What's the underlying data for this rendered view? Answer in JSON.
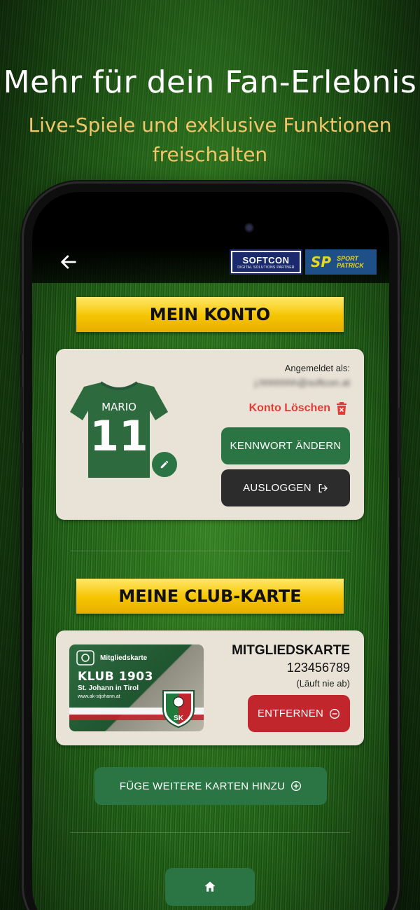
{
  "hero": {
    "title": "Mehr für dein Fan-Erlebnis",
    "subtitle": "Live-Spiele und exklusive Funktionen freischalten"
  },
  "header": {
    "back_icon": "arrow-left-icon",
    "logos": {
      "softcon_name": "SOFTCON",
      "softcon_tagline": "DIGITAL SOLUTIONS PARTNER",
      "sp_mark": "SP",
      "sp_line1": "SPORT",
      "sp_line2": "PATRICK"
    }
  },
  "account": {
    "section_title": "MEIN KONTO",
    "jersey_name": "MARIO",
    "jersey_number": "11",
    "logged_in_label": "Angemeldet als:",
    "email": "j.hhhhhhh@softcon.at",
    "delete_label": "Konto Löschen",
    "change_password_label": "KENNWORT ÄNDERN",
    "logout_label": "AUSLOGGEN"
  },
  "club": {
    "section_title": "MEINE CLUB-KARTE",
    "card_image": {
      "header": "Mitgliedskarte",
      "club_name": "KLUB 1903",
      "location": "St. Johann in Tirol",
      "website": "www.ak-stjohann.at",
      "crest_letters": "SK"
    },
    "card_type": "MITGLIEDSKARTE",
    "card_number": "123456789",
    "expiry": "(Läuft nie ab)",
    "remove_label": "ENTFERNEN",
    "add_more_label": "FÜGE WEITERE KARTEN HINZU"
  },
  "colors": {
    "primary_green": "#2b7443",
    "accent_yellow": "#f5c400",
    "danger_red": "#c0262c",
    "subtitle_gold": "#f2c56b"
  }
}
